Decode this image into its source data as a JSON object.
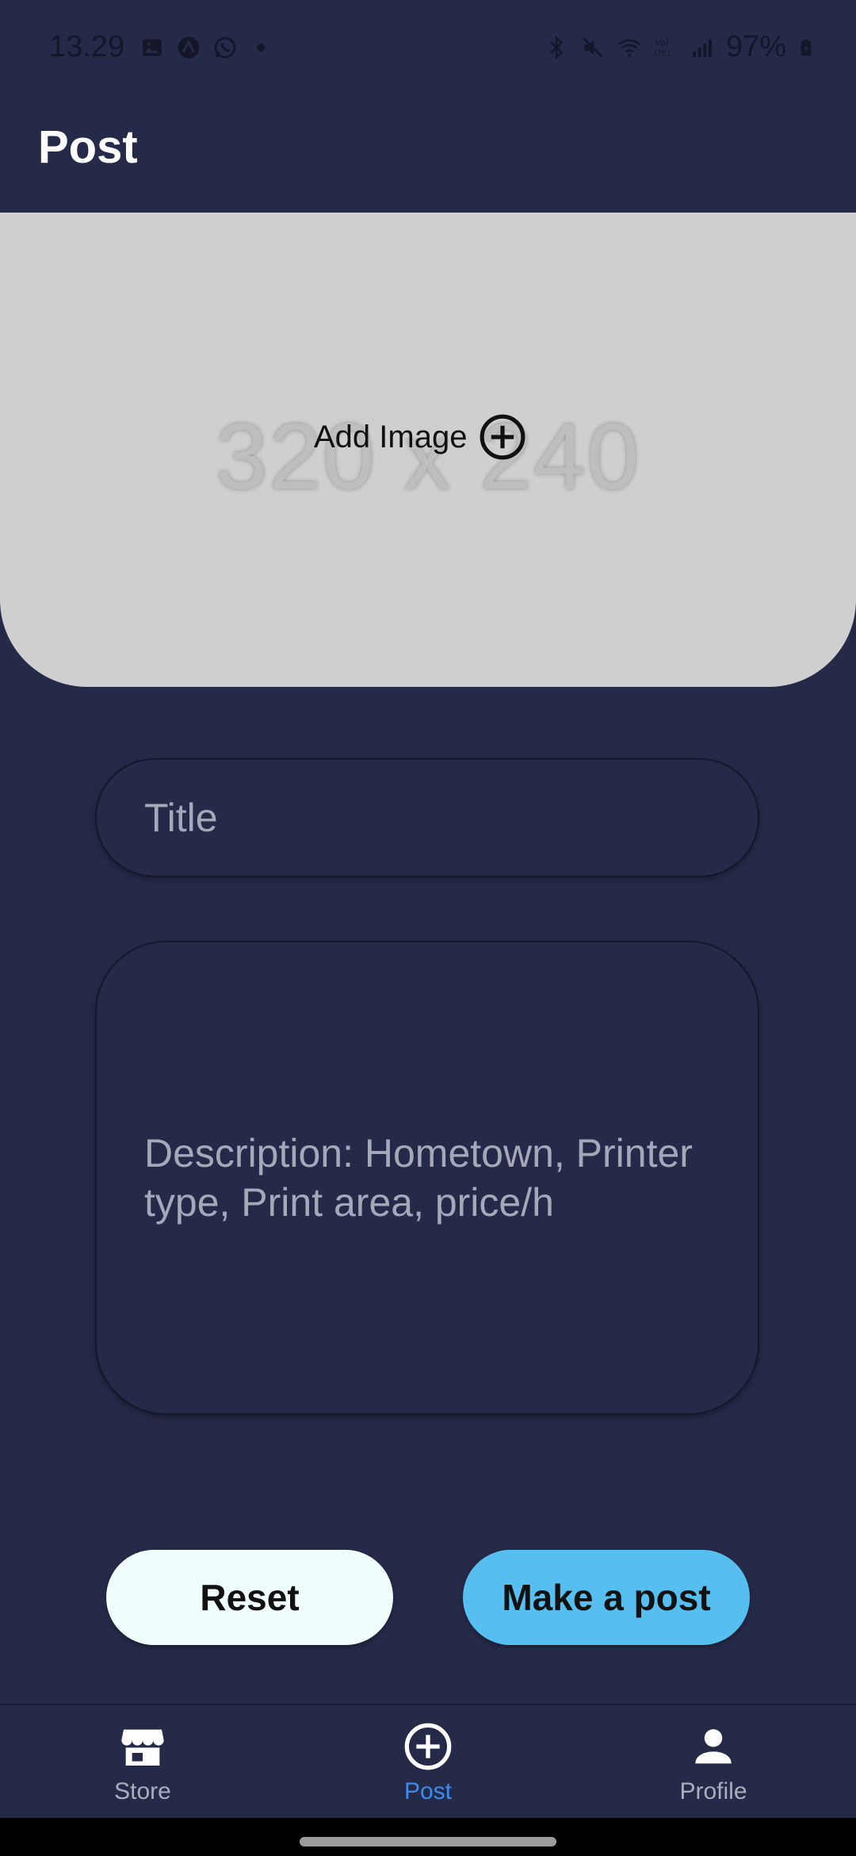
{
  "status_bar": {
    "time": "13.29",
    "battery": "97%",
    "left_icons": [
      "image-icon",
      "app-icon",
      "whatsapp-icon",
      "dot-icon"
    ],
    "right_icons": [
      "bluetooth-icon",
      "mute-icon",
      "wifi-icon",
      "volte-icon",
      "signal-icon",
      "battery-icon"
    ]
  },
  "app_bar": {
    "title": "Post"
  },
  "image_picker": {
    "placeholder_text": "320 x 240",
    "add_label": "Add Image",
    "icon": "add-circle-icon"
  },
  "form": {
    "title_placeholder": "Title",
    "description_placeholder": "Description: Hometown, Printer type, Print area, price/h"
  },
  "buttons": {
    "reset_label": "Reset",
    "post_label": "Make a post"
  },
  "bottom_nav": {
    "items": [
      {
        "label": "Store",
        "icon": "store-icon",
        "active": false
      },
      {
        "label": "Post",
        "icon": "add-circle-icon",
        "active": true
      },
      {
        "label": "Profile",
        "icon": "person-icon",
        "active": false
      }
    ]
  },
  "colors": {
    "background": "#262a49",
    "image_area": "#cfcfcf",
    "reset_button": "#f0fffd",
    "post_button": "#56bff0",
    "active_nav": "#3a8cf0",
    "inactive_nav": "#a9adbd"
  }
}
